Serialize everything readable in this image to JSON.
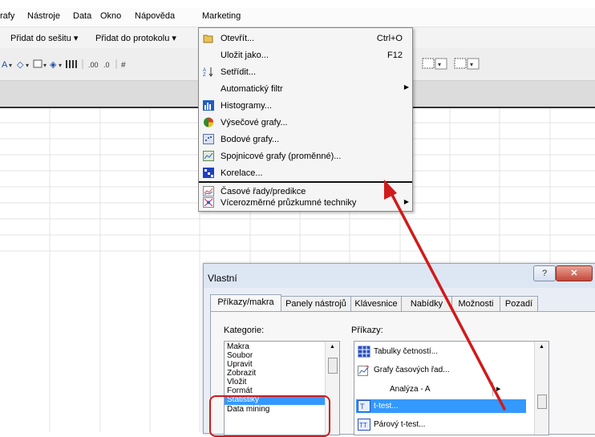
{
  "menubar": {
    "items": [
      "rafy",
      "Nástroje",
      "Data",
      "Okno",
      "Nápověda",
      "Marketing"
    ]
  },
  "toolbar": {
    "add_to_workbook": "Přidat do sešitu ▾",
    "add_to_report": "Přidat do protokolu ▾"
  },
  "menu": {
    "items": [
      {
        "label": "Otevřít...",
        "shortcut": "Ctrl+O",
        "icon": "open-folder-icon"
      },
      {
        "label": "Uložit jako...",
        "shortcut": "F12",
        "icon": ""
      },
      {
        "label": "Setřídit...",
        "shortcut": "",
        "icon": "sort-az-icon"
      },
      {
        "label": "Automatický filtr",
        "shortcut": "",
        "icon": "",
        "submenu": true
      },
      {
        "label": "Histogramy...",
        "shortcut": "",
        "icon": "histogram-icon"
      },
      {
        "label": "Výsečové grafy...",
        "shortcut": "",
        "icon": "pie-chart-icon"
      },
      {
        "label": "Bodové grafy...",
        "shortcut": "",
        "icon": "scatter-chart-icon"
      },
      {
        "label": "Spojnicové grafy (proměnné)...",
        "shortcut": "",
        "icon": "line-chart-icon"
      },
      {
        "label": "Korelace...",
        "shortcut": "",
        "icon": "correlation-icon"
      },
      {
        "label": "Časové řady/predikce",
        "shortcut": "",
        "icon": "time-series-icon"
      },
      {
        "label": "Vícerozměrné průzkumné techniky",
        "shortcut": "",
        "icon": "multivariate-icon",
        "submenu": true
      }
    ]
  },
  "dialog": {
    "title": "Vlastní",
    "help_button": "?",
    "close_button": "✕",
    "tabs": [
      "Příkazy/makra",
      "Panely nástrojů",
      "Klávesnice",
      "Nabídky",
      "Možnosti",
      "Pozadí"
    ],
    "category_label": "Kategorie:",
    "categories": [
      "Makra",
      "Soubor",
      "Upravit",
      "Zobrazit",
      "Vložit",
      "Formát",
      "Statistiky",
      "Data mining"
    ],
    "selected_category": "Statistiky",
    "commands_label": "Příkazy:",
    "commands": [
      {
        "label": "Tabulky četností...",
        "icon": "frequency-table-icon"
      },
      {
        "label": "Grafy časových řad...",
        "icon": "time-series-chart-icon"
      },
      {
        "label": "Analýza - A",
        "icon": "",
        "submenu": true
      },
      {
        "label": "t-test...",
        "icon": "t-test-icon"
      },
      {
        "label": "Párový t-test...",
        "icon": "paired-t-test-icon"
      }
    ],
    "selected_command": "t-test..."
  },
  "colors": {
    "annotation_red": "#d11a1a",
    "selection_blue": "#3399ff",
    "menu_bg": "#f5f5f5"
  }
}
